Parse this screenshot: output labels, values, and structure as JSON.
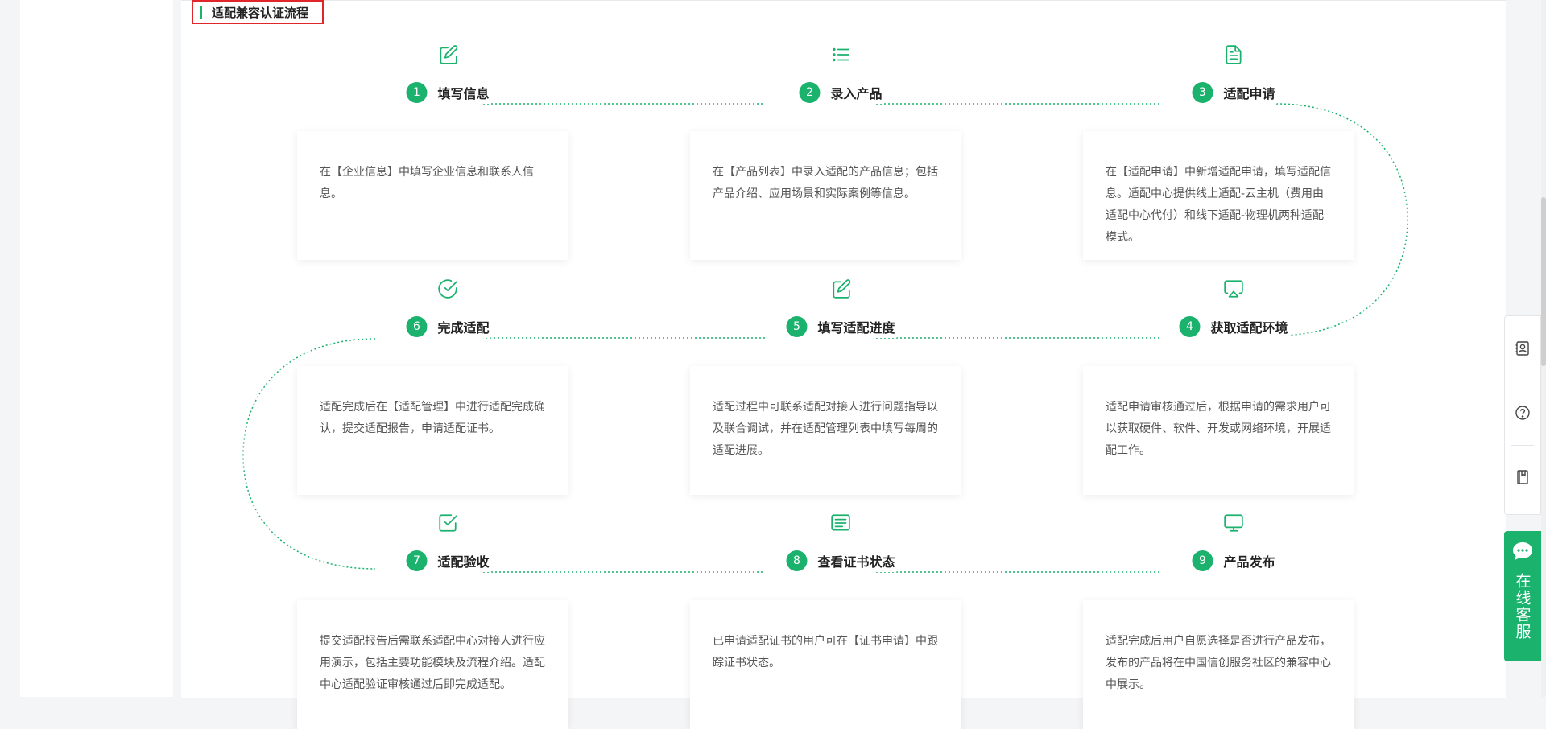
{
  "section_title": "适配兼容认证流程",
  "accent_color": "#1ab26d",
  "steps": [
    {
      "num": "1",
      "title": "填写信息",
      "icon": "edit-icon",
      "desc": "在【企业信息】中填写企业信息和联系人信息。"
    },
    {
      "num": "2",
      "title": "录入产品",
      "icon": "list-icon",
      "desc": "在【产品列表】中录入适配的产品信息；包括产品介绍、应用场景和实际案例等信息。"
    },
    {
      "num": "3",
      "title": "适配申请",
      "icon": "document-icon",
      "desc": "在【适配申请】中新增适配申请，填写适配信息。适配中心提供线上适配-云主机（费用由适配中心代付）和线下适配-物理机两种适配模式。"
    },
    {
      "num": "4",
      "title": "获取适配环境",
      "icon": "airplay-icon",
      "desc": "适配申请审核通过后，根据申请的需求用户可以获取硬件、软件、开发或网络环境，开展适配工作。"
    },
    {
      "num": "5",
      "title": "填写适配进度",
      "icon": "edit-icon",
      "desc": "适配过程中可联系适配对接人进行问题指导以及联合调试，并在适配管理列表中填写每周的适配进展。"
    },
    {
      "num": "6",
      "title": "完成适配",
      "icon": "check-circle-icon",
      "desc": "适配完成后在【适配管理】中进行适配完成确认，提交适配报告，申请适配证书。"
    },
    {
      "num": "7",
      "title": "适配验收",
      "icon": "check-square-icon",
      "desc": "提交适配报告后需联系适配中心对接人进行应用演示，包括主要功能模块及流程介绍。适配中心适配验证审核通过后即完成适配。"
    },
    {
      "num": "8",
      "title": "查看证书状态",
      "icon": "message-icon",
      "desc": "已申请适配证书的用户可在【证书申请】中跟踪证书状态。"
    },
    {
      "num": "9",
      "title": "产品发布",
      "icon": "monitor-icon",
      "desc": "适配完成后用户自愿选择是否进行产品发布，发布的产品将在中国信创服务社区的兼容中心中展示。"
    }
  ],
  "side_tools": [
    "contact-card-icon",
    "help-icon",
    "bookmark-icon"
  ],
  "chat": {
    "label": "在线客服",
    "icon": "chat-bubble-icon"
  }
}
